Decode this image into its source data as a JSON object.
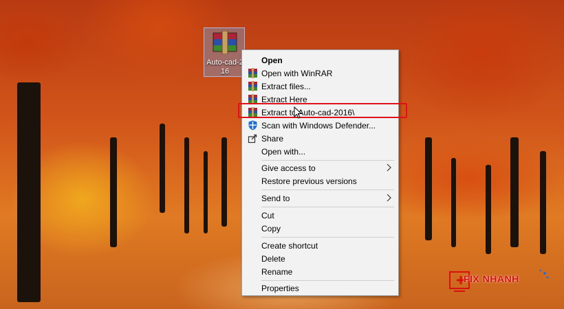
{
  "desktop_icon": {
    "label_line1": "Auto-cad-2",
    "label_line2": "16",
    "icon": "winrar-archive-icon"
  },
  "context_menu": {
    "items": [
      {
        "label": "Open",
        "icon": "none",
        "bold": true
      },
      {
        "label": "Open with WinRAR",
        "icon": "winrar-icon"
      },
      {
        "label": "Extract files...",
        "icon": "winrar-icon"
      },
      {
        "label": "Extract Here",
        "icon": "winrar-icon"
      },
      {
        "label": "Extract to Auto-cad-2016\\",
        "icon": "winrar-icon",
        "highlighted": true
      },
      {
        "label": "Scan with Windows Defender...",
        "icon": "defender-icon"
      },
      {
        "label": "Share",
        "icon": "share-icon"
      },
      {
        "label": "Open with...",
        "icon": "none"
      },
      {
        "label": "Give access to",
        "icon": "none",
        "submenu": true
      },
      {
        "label": "Restore previous versions",
        "icon": "none"
      },
      {
        "label": "Send to",
        "icon": "none",
        "submenu": true
      },
      {
        "label": "Cut",
        "icon": "none"
      },
      {
        "label": "Copy",
        "icon": "none"
      },
      {
        "label": "Create shortcut",
        "icon": "none"
      },
      {
        "label": "Delete",
        "icon": "none"
      },
      {
        "label": "Rename",
        "icon": "none"
      },
      {
        "label": "Properties",
        "icon": "none"
      }
    ]
  },
  "watermark": {
    "brand": "FIX NHANH"
  },
  "colors": {
    "highlight_border": "#e0101a",
    "menu_bg": "#f2f2f2"
  }
}
